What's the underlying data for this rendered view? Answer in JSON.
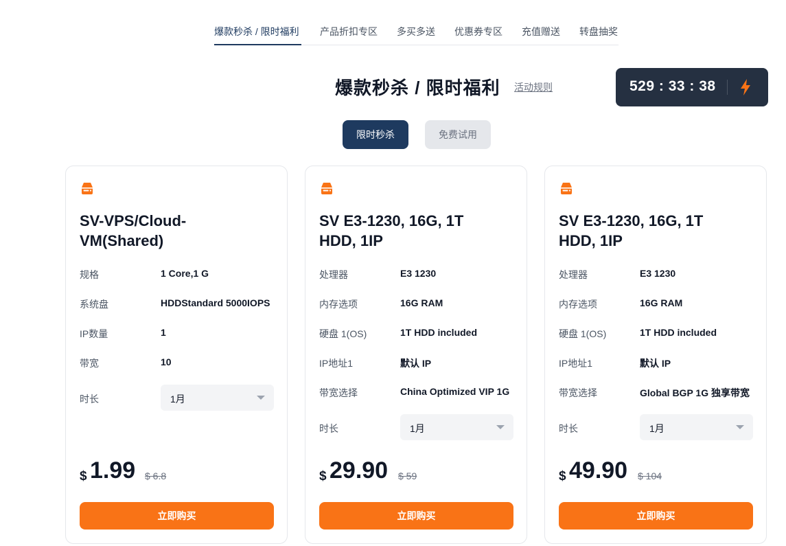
{
  "tabs": [
    "爆款秒杀 / 限时福利",
    "产品折扣专区",
    "多买多送",
    "优惠券专区",
    "充值赠送",
    "转盘抽奖"
  ],
  "page_title": "爆款秒杀 / 限时福利",
  "rules_link": "活动规则",
  "countdown": "529 : 33 : 38",
  "segments": {
    "active": "限时秒杀",
    "inactive": "免费试用"
  },
  "colors": {
    "accent": "#f97316",
    "navy": "#1e3a5f",
    "countdown_bg": "#253041"
  },
  "icons": {
    "card": "server-icon",
    "countdown": "lightning-icon",
    "select": "chevron-down-icon"
  },
  "cards": [
    {
      "title": "SV-VPS/Cloud-VM(Shared)",
      "specs": [
        {
          "label": "规格",
          "value": "1 Core,1 G"
        },
        {
          "label": "系统盘",
          "value": "HDDStandard 5000IOPS"
        },
        {
          "label": "IP数量",
          "value": "1"
        },
        {
          "label": "带宽",
          "value": "10"
        }
      ],
      "duration_label": "时长",
      "duration_value": "1月",
      "currency": "$",
      "price": "1.99",
      "old_price": "$ 6.8",
      "buy_label": "立即购买"
    },
    {
      "title": "SV E3-1230, 16G, 1T HDD, 1IP",
      "specs": [
        {
          "label": "处理器",
          "value": "E3 1230"
        },
        {
          "label": "内存选项",
          "value": "16G RAM"
        },
        {
          "label": "硬盘 1(OS)",
          "value": "1T HDD included"
        },
        {
          "label": "IP地址1",
          "value": "默认 IP"
        },
        {
          "label": "带宽选择",
          "value": "China Optimized VIP 1G"
        }
      ],
      "duration_label": "时长",
      "duration_value": "1月",
      "currency": "$",
      "price": "29.90",
      "old_price": "$ 59",
      "buy_label": "立即购买"
    },
    {
      "title": "SV E3-1230, 16G, 1T HDD, 1IP",
      "specs": [
        {
          "label": "处理器",
          "value": "E3 1230"
        },
        {
          "label": "内存选项",
          "value": "16G RAM"
        },
        {
          "label": "硬盘 1(OS)",
          "value": "1T HDD included"
        },
        {
          "label": "IP地址1",
          "value": "默认 IP"
        },
        {
          "label": "带宽选择",
          "value": "Global BGP 1G 独享带宽"
        }
      ],
      "duration_label": "时长",
      "duration_value": "1月",
      "currency": "$",
      "price": "49.90",
      "old_price": "$ 104",
      "buy_label": "立即购买"
    }
  ]
}
